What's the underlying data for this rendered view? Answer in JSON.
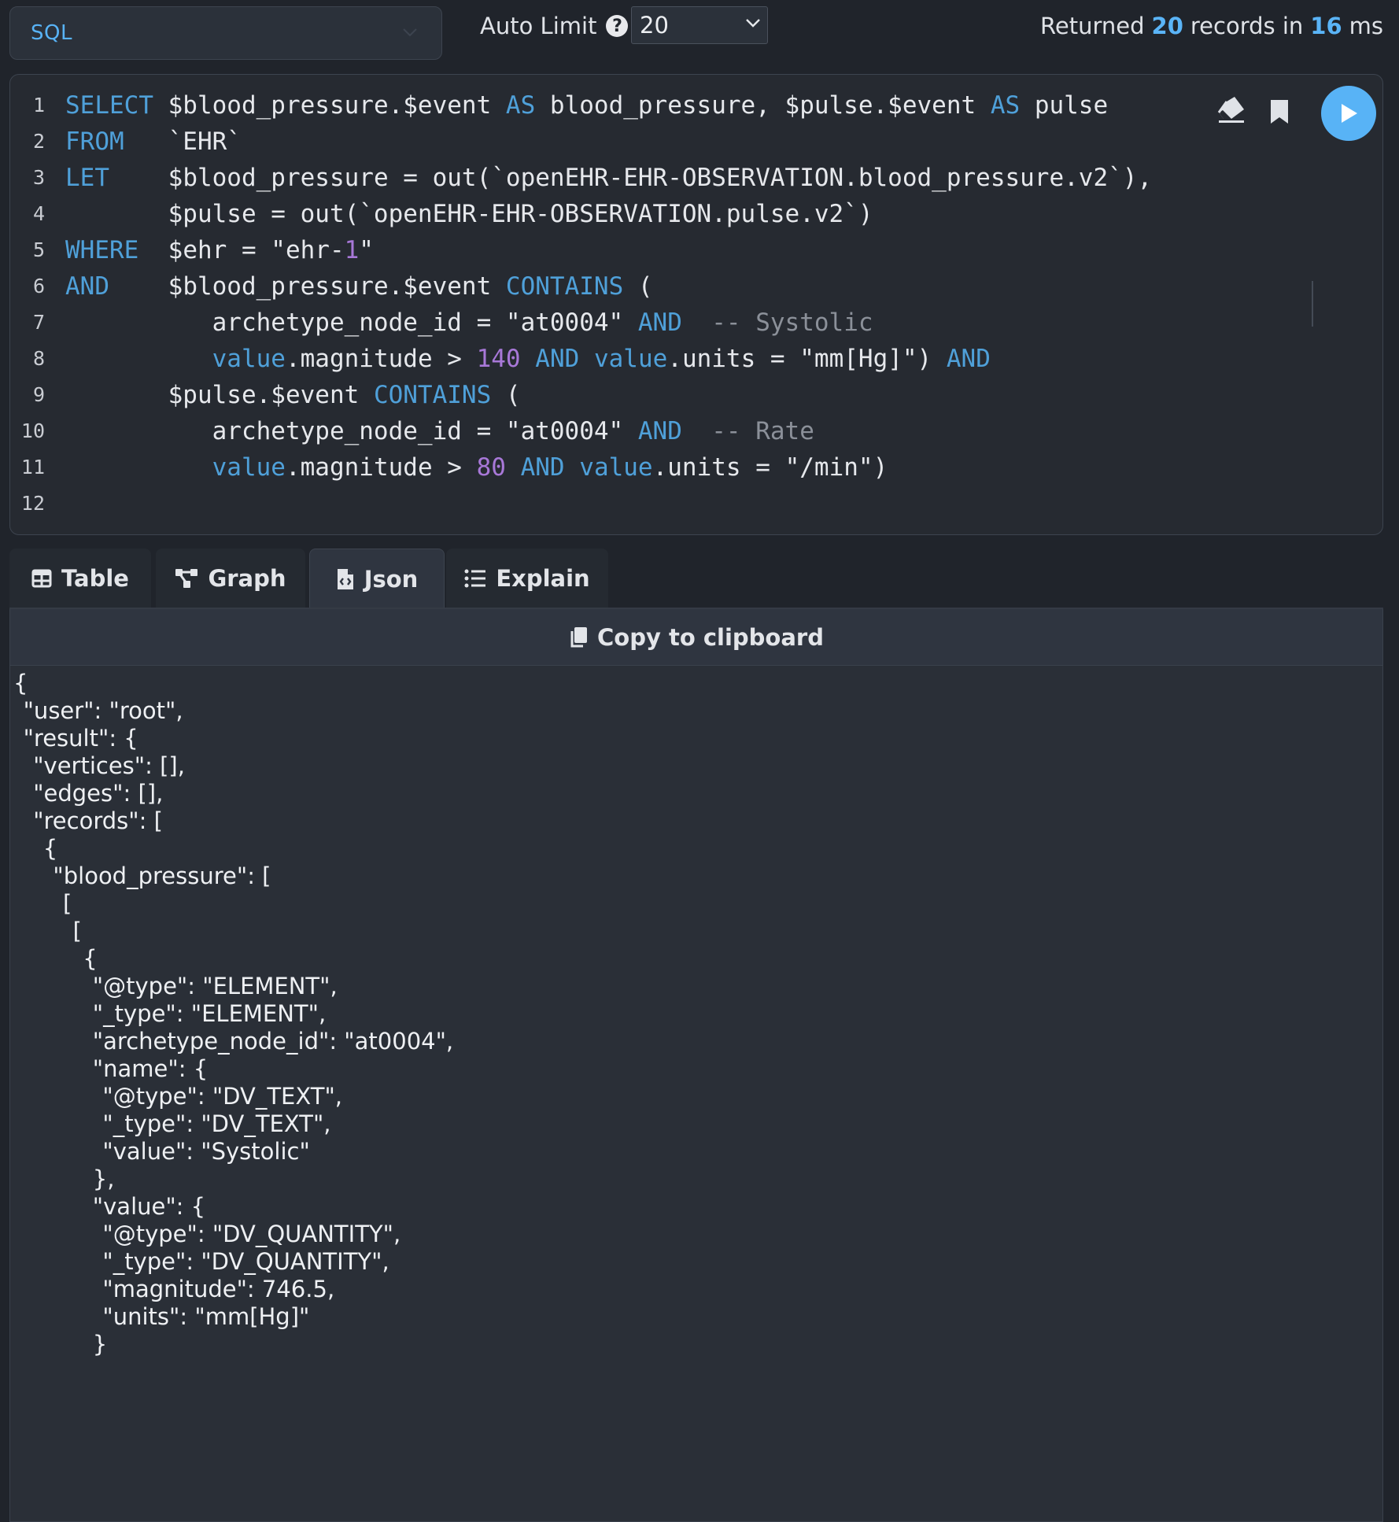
{
  "toolbar": {
    "language": "SQL",
    "auto_limit_label": "Auto Limit",
    "help_glyph": "?",
    "limit_value": "20",
    "returned_prefix": "Returned",
    "returned_count": "20",
    "returned_mid": "records in",
    "returned_time": "16",
    "returned_unit": "ms"
  },
  "editor": {
    "line_numbers": [
      "1",
      "2",
      "3",
      "4",
      "5",
      "6",
      "7",
      "8",
      "9",
      "10",
      "11",
      "12"
    ],
    "lines": [
      [
        [
          "k",
          "SELECT"
        ],
        [
          "t",
          " $blood_pressure.$event "
        ],
        [
          "k",
          "AS"
        ],
        [
          "t",
          " blood_pressure, $pulse.$event "
        ],
        [
          "k",
          "AS"
        ],
        [
          "t",
          " pulse"
        ]
      ],
      [
        [
          "k",
          "FROM"
        ],
        [
          "t",
          "   `EHR`"
        ]
      ],
      [
        [
          "k",
          "LET"
        ],
        [
          "t",
          "    $blood_pressure = out(`openEHR-EHR-OBSERVATION.blood_pressure.v2`),"
        ]
      ],
      [
        [
          "t",
          "       $pulse = out(`openEHR-EHR-OBSERVATION.pulse.v2`)"
        ]
      ],
      [
        [
          "k",
          "WHERE"
        ],
        [
          "t",
          "  $ehr = \"ehr-"
        ],
        [
          "n",
          "1"
        ],
        [
          "t",
          "\""
        ]
      ],
      [
        [
          "k",
          "AND"
        ],
        [
          "t",
          "    $blood_pressure.$event "
        ],
        [
          "k",
          "CONTAINS"
        ],
        [
          "t",
          " ("
        ]
      ],
      [
        [
          "t",
          "          archetype_node_id = \"at0004\" "
        ],
        [
          "k",
          "AND"
        ],
        [
          "t",
          "  "
        ],
        [
          "c",
          "-- Systolic"
        ]
      ],
      [
        [
          "t",
          "          "
        ],
        [
          "k",
          "value"
        ],
        [
          "t",
          ".magnitude > "
        ],
        [
          "n",
          "140"
        ],
        [
          "t",
          " "
        ],
        [
          "k",
          "AND"
        ],
        [
          "t",
          " "
        ],
        [
          "k",
          "value"
        ],
        [
          "t",
          ".units = \"mm[Hg]\") "
        ],
        [
          "k",
          "AND"
        ]
      ],
      [
        [
          "t",
          "       $pulse.$event "
        ],
        [
          "k",
          "CONTAINS"
        ],
        [
          "t",
          " ("
        ]
      ],
      [
        [
          "t",
          "          archetype_node_id = \"at0004\" "
        ],
        [
          "k",
          "AND"
        ],
        [
          "t",
          "  "
        ],
        [
          "c",
          "-- Rate"
        ]
      ],
      [
        [
          "t",
          "          "
        ],
        [
          "k",
          "value"
        ],
        [
          "t",
          ".magnitude > "
        ],
        [
          "n",
          "80"
        ],
        [
          "t",
          " "
        ],
        [
          "k",
          "AND"
        ],
        [
          "t",
          " "
        ],
        [
          "k",
          "value"
        ],
        [
          "t",
          ".units = \"/min\")"
        ]
      ],
      [
        [
          "t",
          ""
        ]
      ]
    ],
    "icons": [
      "eraser-icon",
      "bookmark-icon",
      "play-icon"
    ]
  },
  "tabs": [
    {
      "label": "Table",
      "icon": "table-icon",
      "active": false
    },
    {
      "label": "Graph",
      "icon": "graph-icon",
      "active": false
    },
    {
      "label": "Json",
      "icon": "json-file-icon",
      "active": true
    },
    {
      "label": "Explain",
      "icon": "list-icon",
      "active": false
    }
  ],
  "json_view": {
    "copy_label": "Copy to clipboard",
    "lines": [
      [
        0,
        "{"
      ],
      [
        1,
        "\"user\": \"root\","
      ],
      [
        1,
        "\"result\": {"
      ],
      [
        2,
        "\"vertices\": [],"
      ],
      [
        2,
        "\"edges\": [],"
      ],
      [
        2,
        "\"records\": ["
      ],
      [
        3,
        "{"
      ],
      [
        4,
        "\"blood_pressure\": ["
      ],
      [
        5,
        "["
      ],
      [
        6,
        "["
      ],
      [
        7,
        "{"
      ],
      [
        8,
        "\"@type\": \"ELEMENT\","
      ],
      [
        8,
        "\"_type\": \"ELEMENT\","
      ],
      [
        8,
        "\"archetype_node_id\": \"at0004\","
      ],
      [
        8,
        "\"name\": {"
      ],
      [
        9,
        "\"@type\": \"DV_TEXT\","
      ],
      [
        9,
        "\"_type\": \"DV_TEXT\","
      ],
      [
        9,
        "\"value\": \"Systolic\""
      ],
      [
        8,
        "},"
      ],
      [
        8,
        "\"value\": {"
      ],
      [
        9,
        "\"@type\": \"DV_QUANTITY\","
      ],
      [
        9,
        "\"_type\": \"DV_QUANTITY\","
      ],
      [
        9,
        "\"magnitude\": 746.5,"
      ],
      [
        9,
        "\"units\": \"mm[Hg]\""
      ],
      [
        8,
        "}"
      ]
    ]
  },
  "colors": {
    "accent": "#58b3f6",
    "keyword": "#4fa0d9",
    "number": "#a878d8",
    "comment": "#8b9099",
    "background": "#20242b"
  }
}
